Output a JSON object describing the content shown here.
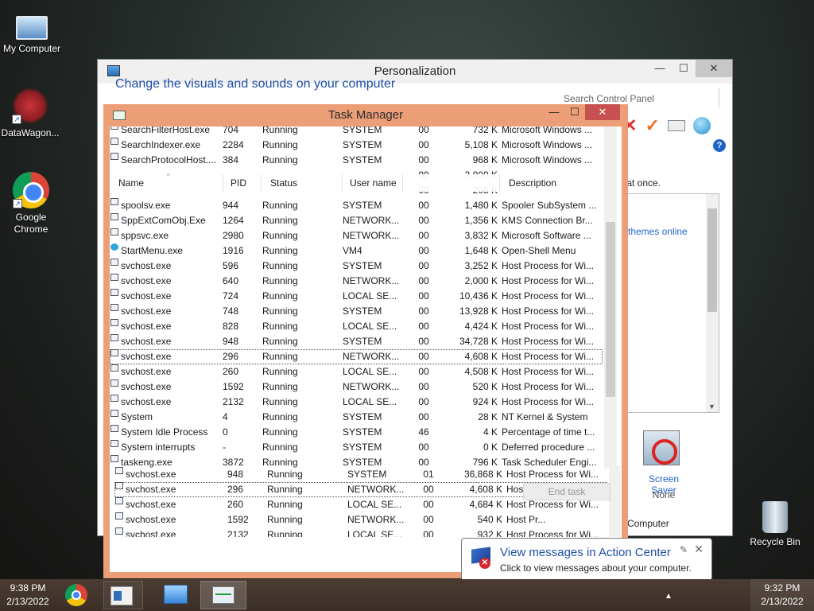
{
  "desktop": {
    "icons": [
      {
        "label": "My Computer"
      },
      {
        "label": "DataWagon..."
      },
      {
        "label": "Google Chrome"
      },
      {
        "label": "Recycle Bin"
      }
    ]
  },
  "personalization": {
    "title": "Personalization",
    "heading": "Change the visuals and sounds on your computer",
    "search_placeholder": "Search Control Panel",
    "all_at_once": "all at once.",
    "themes_online": "themes online",
    "screen_saver_label": "Screen Saver",
    "screen_saver_value": "None",
    "computer_text": "Computer",
    "help": "?",
    "min": "—",
    "max": "☐",
    "close": "✕"
  },
  "task_manager": {
    "title": "Task Manager",
    "min": "—",
    "max": "☐",
    "close": "✕",
    "columns": {
      "name": "Name",
      "pid": "PID",
      "status": "Status",
      "user": "User name",
      "cpu": "",
      "memory": "",
      "desc": "Description"
    },
    "rows": [
      {
        "name": "SearchFilterHost.exe",
        "pid": "704",
        "status": "Running",
        "user": "SYSTEM",
        "cpu": "00",
        "mem": "732 K",
        "desc": "Microsoft Windows ..."
      },
      {
        "name": "SearchIndexer.exe",
        "pid": "2284",
        "status": "Running",
        "user": "SYSTEM",
        "cpu": "00",
        "mem": "5,108 K",
        "desc": "Microsoft Windows ..."
      },
      {
        "name": "SearchProtocolHost....",
        "pid": "384",
        "status": "Running",
        "user": "SYSTEM",
        "cpu": "00",
        "mem": "968 K",
        "desc": "Microsoft Windows ..."
      },
      {
        "name": "",
        "pid": "",
        "status": "",
        "user": "",
        "cpu": "00",
        "mem": "2,000 K",
        "desc": ""
      },
      {
        "name": "",
        "pid": "",
        "status": "",
        "user": "",
        "cpu": "00",
        "mem": "208 K",
        "desc": ""
      },
      {
        "name": "spoolsv.exe",
        "pid": "944",
        "status": "Running",
        "user": "SYSTEM",
        "cpu": "00",
        "mem": "1,480 K",
        "desc": "Spooler SubSystem ..."
      },
      {
        "name": "SppExtComObj.Exe",
        "pid": "1264",
        "status": "Running",
        "user": "NETWORK...",
        "cpu": "00",
        "mem": "1,356 K",
        "desc": "KMS Connection Br..."
      },
      {
        "name": "sppsvc.exe",
        "pid": "2980",
        "status": "Running",
        "user": "NETWORK...",
        "cpu": "00",
        "mem": "3,832 K",
        "desc": "Microsoft Software ..."
      },
      {
        "name": "StartMenu.exe",
        "pid": "1916",
        "status": "Running",
        "user": "VM4",
        "cpu": "00",
        "mem": "1,648 K",
        "desc": "Open-Shell Menu"
      },
      {
        "name": "svchost.exe",
        "pid": "596",
        "status": "Running",
        "user": "SYSTEM",
        "cpu": "00",
        "mem": "3,252 K",
        "desc": "Host Process for Wi..."
      },
      {
        "name": "svchost.exe",
        "pid": "640",
        "status": "Running",
        "user": "NETWORK...",
        "cpu": "00",
        "mem": "2,000 K",
        "desc": "Host Process for Wi..."
      },
      {
        "name": "svchost.exe",
        "pid": "724",
        "status": "Running",
        "user": "LOCAL SE...",
        "cpu": "00",
        "mem": "10,436 K",
        "desc": "Host Process for Wi..."
      },
      {
        "name": "svchost.exe",
        "pid": "748",
        "status": "Running",
        "user": "SYSTEM",
        "cpu": "00",
        "mem": "13,928 K",
        "desc": "Host Process for Wi..."
      },
      {
        "name": "svchost.exe",
        "pid": "828",
        "status": "Running",
        "user": "LOCAL SE...",
        "cpu": "00",
        "mem": "4,424 K",
        "desc": "Host Process for Wi..."
      },
      {
        "name": "svchost.exe",
        "pid": "948",
        "status": "Running",
        "user": "SYSTEM",
        "cpu": "00",
        "mem": "34,728 K",
        "desc": "Host Process for Wi..."
      },
      {
        "name": "svchost.exe",
        "pid": "296",
        "status": "Running",
        "user": "NETWORK...",
        "cpu": "00",
        "mem": "4,608 K",
        "desc": "Host Process for Wi..."
      },
      {
        "name": "svchost.exe",
        "pid": "260",
        "status": "Running",
        "user": "LOCAL SE...",
        "cpu": "00",
        "mem": "4,508 K",
        "desc": "Host Process for Wi..."
      },
      {
        "name": "svchost.exe",
        "pid": "1592",
        "status": "Running",
        "user": "NETWORK...",
        "cpu": "00",
        "mem": "520 K",
        "desc": "Host Process for Wi..."
      },
      {
        "name": "svchost.exe",
        "pid": "2132",
        "status": "Running",
        "user": "LOCAL SE...",
        "cpu": "00",
        "mem": "924 K",
        "desc": "Host Process for Wi..."
      },
      {
        "name": "System",
        "pid": "4",
        "status": "Running",
        "user": "SYSTEM",
        "cpu": "00",
        "mem": "28 K",
        "desc": "NT Kernel & System"
      },
      {
        "name": "System Idle Process",
        "pid": "0",
        "status": "Running",
        "user": "SYSTEM",
        "cpu": "46",
        "mem": "4 K",
        "desc": "Percentage of time t..."
      },
      {
        "name": "System interrupts",
        "pid": "-",
        "status": "Running",
        "user": "SYSTEM",
        "cpu": "00",
        "mem": "0 K",
        "desc": "Deferred procedure ..."
      },
      {
        "name": "taskeng.exe",
        "pid": "3872",
        "status": "Running",
        "user": "SYSTEM",
        "cpu": "00",
        "mem": "796 K",
        "desc": "Task Scheduler Engi..."
      }
    ],
    "selected_index": 15,
    "lower_rows": [
      {
        "name": "svchost.exe",
        "pid": "948",
        "status": "Running",
        "user": "SYSTEM",
        "cpu": "01",
        "mem": "36,868 K",
        "desc": "Host Process for Wi..."
      },
      {
        "name": "svchost.exe",
        "pid": "296",
        "status": "Running",
        "user": "NETWORK...",
        "cpu": "00",
        "mem": "4,608 K",
        "desc": "Host Process for Wi..."
      },
      {
        "name": "svchost.exe",
        "pid": "260",
        "status": "Running",
        "user": "LOCAL SE...",
        "cpu": "00",
        "mem": "4,684 K",
        "desc": "Host Process for Wi..."
      },
      {
        "name": "svchost.exe",
        "pid": "1592",
        "status": "Running",
        "user": "NETWORK...",
        "cpu": "00",
        "mem": "540 K",
        "desc": "Host Pr..."
      },
      {
        "name": "svchost.exe",
        "pid": "2132",
        "status": "Running",
        "user": "LOCAL SE...",
        "cpu": "00",
        "mem": "932 K",
        "desc": "Host Process for Wi..."
      }
    ],
    "lower_selected_index": 1,
    "end_task_label": "End task"
  },
  "notification": {
    "title": "View messages in Action Center",
    "body": "Click to view messages about your computer.",
    "badge": "✕",
    "pin": "✎",
    "close": "✕"
  },
  "taskbar": {
    "left_time": "9:38 PM",
    "left_date": "2/13/2022",
    "right_time": "9:32 PM",
    "right_date": "2/13/2022",
    "tray_arrow": "▲"
  }
}
